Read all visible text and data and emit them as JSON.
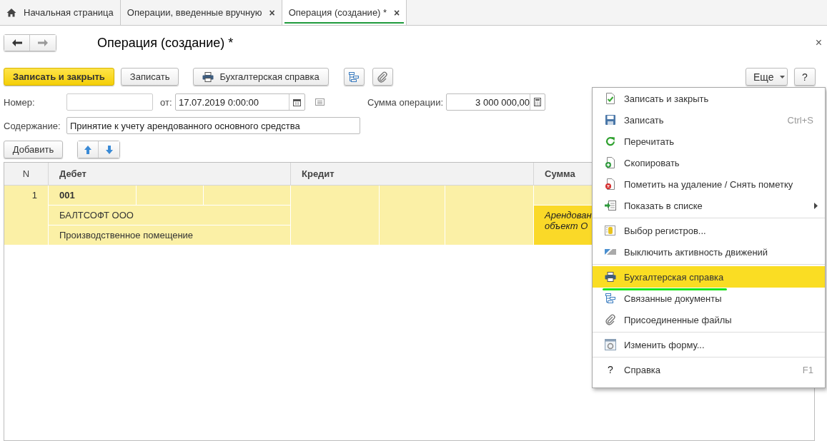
{
  "tabs": [
    {
      "kind": "home",
      "label": "Начальная страница",
      "selected": false
    },
    {
      "kind": "doc",
      "label": "Операции, введенные вручную",
      "close": "×",
      "selected": false
    },
    {
      "kind": "doc",
      "label": "Операция (создание) *",
      "close": "×",
      "selected": true
    }
  ],
  "form": {
    "title": "Операция (создание) *",
    "close": "×",
    "buttons": [
      {
        "kind": "primary",
        "label": "Записать и закрыть"
      },
      {
        "kind": "plain",
        "label": "Записать"
      },
      {
        "kind": "print",
        "label": "Бухгалтерская справка"
      },
      {
        "kind": "structure"
      },
      {
        "kind": "attach"
      }
    ],
    "more_button": "Еще",
    "help_button": "?",
    "number": {
      "label": "Номер:"
    },
    "date": {
      "label": "от:",
      "value": "17.07.2019  0:00:00"
    },
    "sum": {
      "label": "Сумма операции:",
      "value": "3 000 000,00"
    },
    "content": {
      "label": "Содержание:",
      "value": "Принятие к учету арендованного основного средства"
    },
    "add_button": "Добавить"
  },
  "table": {
    "columns": [
      "N",
      "Дебет",
      "Кредит",
      "Сумма"
    ],
    "rows": [
      {
        "n": "1",
        "selected": true,
        "debit": [
          "001",
          "БАЛТСОФТ ООО",
          "Производственное помещение"
        ],
        "sum_note": [
          "Арендован",
          "объект О"
        ]
      }
    ]
  },
  "menu": {
    "groups": [
      [
        {
          "kind": "save-close",
          "label": "Записать и закрыть",
          "selected": false
        },
        {
          "kind": "save",
          "label": "Записать",
          "shortcut": "Ctrl+S",
          "selected": false
        },
        {
          "kind": "reread",
          "label": "Перечитать",
          "selected": false
        },
        {
          "kind": "copy",
          "label": "Скопировать",
          "selected": false
        },
        {
          "kind": "delete",
          "label": "Пометить на удаление / Снять пометку",
          "selected": false
        },
        {
          "kind": "list",
          "label": "Показать в списке",
          "submenu": true,
          "selected": false
        }
      ],
      [
        {
          "kind": "registers",
          "label": "Выбор регистров...",
          "selected": false
        },
        {
          "kind": "toggle",
          "label": "Выключить активность движений",
          "selected": false
        }
      ],
      [
        {
          "kind": "print",
          "label": "Бухгалтерская справка",
          "selected": true,
          "underlined": true
        },
        {
          "kind": "structure",
          "label": "Связанные документы",
          "selected": false
        },
        {
          "kind": "attach",
          "label": "Присоединенные файлы",
          "selected": false
        }
      ],
      [
        {
          "kind": "form",
          "label": "Изменить форму...",
          "selected": false
        }
      ],
      [
        {
          "kind": "help",
          "glyph": "?",
          "label": "Справка",
          "shortcut": "F1",
          "selected": false
        }
      ]
    ]
  }
}
